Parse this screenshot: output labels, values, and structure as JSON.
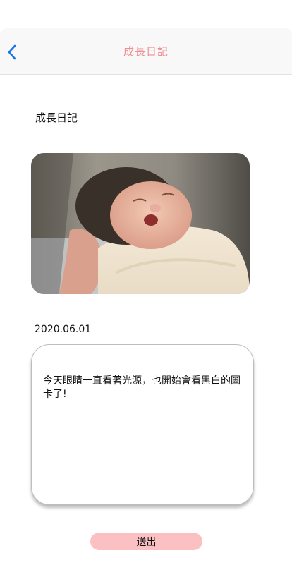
{
  "header": {
    "title": "成長日記",
    "back_icon": "chevron-left-icon",
    "title_color": "#f08d92",
    "back_color": "#1a73e8"
  },
  "main": {
    "section_title": "成長日記",
    "photo": {
      "subject": "newborn-baby-photo"
    },
    "date": "2020.06.01",
    "diary_text": "今天眼睛一直看著光源，也開始會看黑白的圖卡了!"
  },
  "footer": {
    "submit_label": "送出",
    "submit_color": "#fbc0c2"
  }
}
